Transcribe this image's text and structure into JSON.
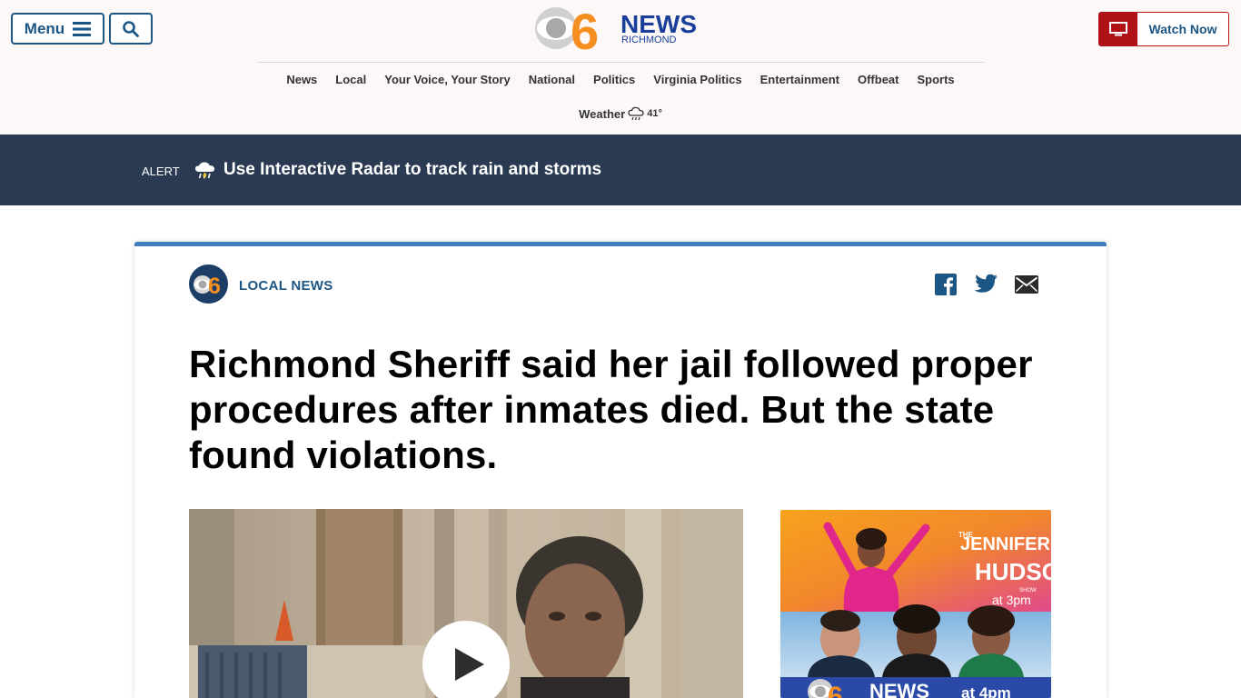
{
  "header": {
    "menu_label": "Menu",
    "logo": {
      "number": "6",
      "name": "NEWS",
      "city": "RICHMOND"
    },
    "watch_label": "Watch Now"
  },
  "nav": {
    "items": [
      "News",
      "Local",
      "Your Voice, Your Story",
      "National",
      "Politics",
      "Virginia Politics",
      "Entertainment",
      "Offbeat",
      "Sports"
    ],
    "weather_label": "Weather",
    "weather_temp": "41°"
  },
  "alert": {
    "label": "ALERT",
    "text": "Use Interactive Radar to track rain and storms"
  },
  "article": {
    "section_logo": "6",
    "section_label": "LOCAL NEWS",
    "headline": "Richmond Sheriff said her jail followed proper procedures after inmates died. But the state found violations."
  },
  "ad": {
    "show_small": "THE",
    "show_name_1": "JENNIFER",
    "show_name_2": "HUDSON",
    "show_suffix": "SHOW",
    "show_time": "at 3pm",
    "news_number": "6",
    "news_name": "NEWS",
    "news_time": "at 4pm"
  },
  "colors": {
    "brand_blue": "#1c5685",
    "watch_red": "#b01117",
    "alert_bg": "#2a3a52",
    "card_accent": "#3d7ebf"
  }
}
